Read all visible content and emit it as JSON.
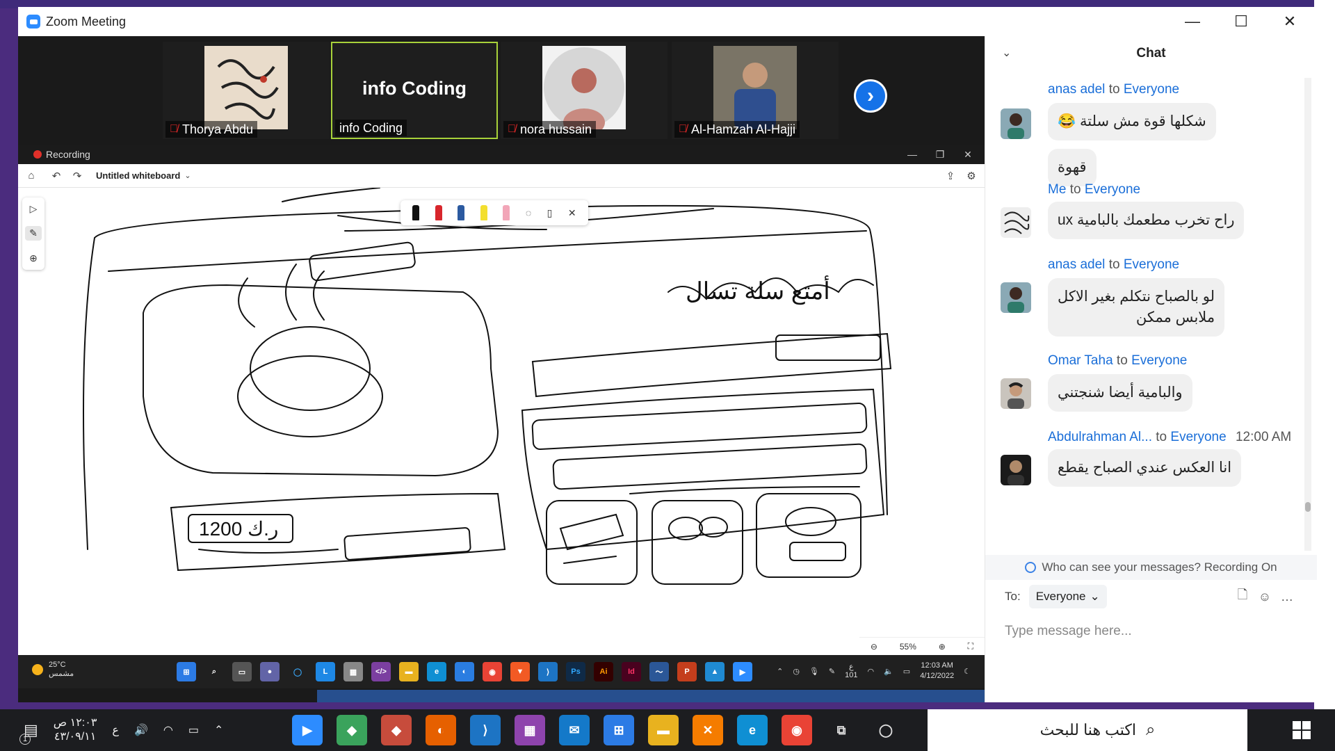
{
  "window": {
    "title": "Zoom Meeting",
    "minimize_icon": "—",
    "maximize_icon": "☐",
    "close_icon": "✕"
  },
  "participants": [
    {
      "name": "Thorya Abdu",
      "muted": true
    },
    {
      "name": "info Coding",
      "muted": false,
      "label": "info Coding",
      "active_speaker": true
    },
    {
      "name": "nora hussain",
      "muted": true
    },
    {
      "name": "Al-Hamzah Al-Hajji",
      "muted": true
    }
  ],
  "share": {
    "recording_label": "Recording",
    "whiteboard_title": "Untitled whiteboard",
    "zoom_level": "55%",
    "sketch_texts": [
      "1200 ر.ك",
      "أمتع سلة تسال"
    ]
  },
  "inner_taskbar": {
    "temperature": "25°C",
    "weather_text": "مشمس",
    "time": "12:03 AM",
    "date": "4/12/2022",
    "keyboard_lang": "ع",
    "keyboard_code": "101"
  },
  "chat": {
    "title": "Chat",
    "messages": [
      {
        "sender": "anas adel",
        "to_word": "to",
        "recipient": "Everyone",
        "time": "",
        "texts": [
          "شكلها قوة مش سلتة 😂",
          "قهوة"
        ]
      },
      {
        "sender": "Me",
        "to_word": "to",
        "recipient": "Everyone",
        "time": "",
        "texts": [
          "راح تخرب مطعمك بالبامية ux"
        ]
      },
      {
        "sender": "anas adel",
        "to_word": "to",
        "recipient": "Everyone",
        "time": "",
        "texts": [
          "لو بالصباح نتكلم بغير الاكل",
          "ملابس ممكن"
        ]
      },
      {
        "sender": "Omar Taha",
        "to_word": "to",
        "recipient": "Everyone",
        "time": "",
        "texts": [
          "والبامية أيضا شنجتني"
        ]
      },
      {
        "sender": "Abdulrahman Al...",
        "to_word": "to",
        "recipient": "Everyone",
        "time": "12:00 AM",
        "texts": [
          "انا العكس عندي الصباح يقطع"
        ]
      }
    ],
    "privacy_text": "Who can see your messages? Recording On",
    "to_label": "To:",
    "to_value": "Everyone",
    "input_placeholder": "Type message here..."
  },
  "outer_taskbar": {
    "time": "١٢:٠٣ ص",
    "date": "٤٣/٠٩/١١",
    "lang": "ع",
    "search_placeholder": "اكتب هنا للبحث",
    "notification_count": "1"
  },
  "colors": {
    "zoom_blue": "#2d8cff",
    "chat_link": "#1a6ed8",
    "active_speaker_border": "#a8d23a",
    "taskbar": "#1c1d20"
  }
}
